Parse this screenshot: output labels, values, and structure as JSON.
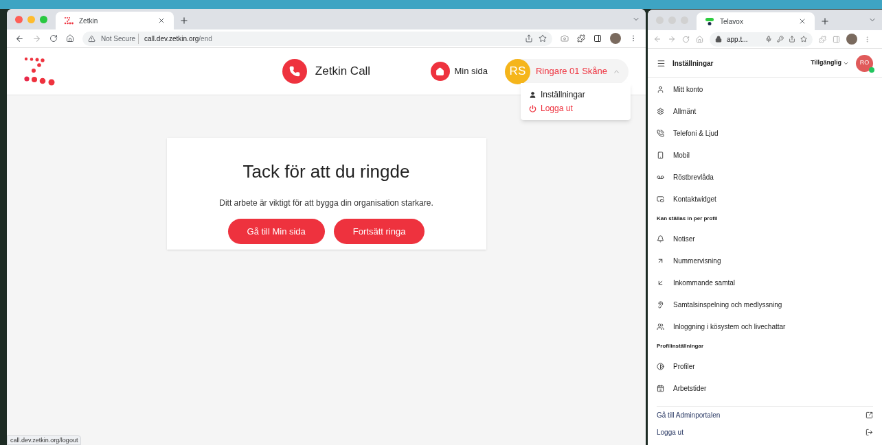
{
  "left_window": {
    "focused": true,
    "tab": {
      "title": "Zetkin"
    },
    "address": {
      "security": "Not Secure",
      "host": "call.dev.zetkin.org",
      "path": "/end"
    },
    "header": {
      "app_title": "Zetkin Call",
      "nav_link": "Min sida",
      "user": {
        "initials": "RS",
        "name": "Ringare 01 Skåne",
        "expanded": true
      }
    },
    "user_menu": [
      {
        "label": "Inställningar",
        "kind": "normal"
      },
      {
        "label": "Logga ut",
        "kind": "danger"
      }
    ],
    "card": {
      "title": "Tack för att du ringde",
      "text": "Ditt arbete är viktigt för att bygga din organisation starkare.",
      "buttons": [
        "Gå till Min sida",
        "Fortsätt ringa"
      ]
    },
    "status_link": "call.dev.zetkin.org/logout"
  },
  "right_window": {
    "focused": false,
    "tab": {
      "title": "Telavox"
    },
    "address": {
      "host": "app.t..."
    },
    "header": {
      "title": "Inställningar",
      "status": "Tillgänglig",
      "initials": "RO",
      "online": true
    },
    "sections": [
      {
        "items": [
          "Mitt konto",
          "Allmänt",
          "Telefoni & Ljud",
          "Mobil",
          "Röstbrevlåda",
          "Kontaktwidget"
        ]
      },
      {
        "heading": "Kan ställas in per profil",
        "items": [
          "Notiser",
          "Nummervisning",
          "Inkommande samtal",
          "Samtalsinspelning och medlyssning",
          "Inloggning i kösystem och livechattar"
        ]
      },
      {
        "heading": "Profilinställningar",
        "items": [
          "Profiler",
          "Arbetstider"
        ]
      }
    ],
    "footer_links": [
      "Gå till Adminportalen",
      "Logga ut"
    ]
  }
}
